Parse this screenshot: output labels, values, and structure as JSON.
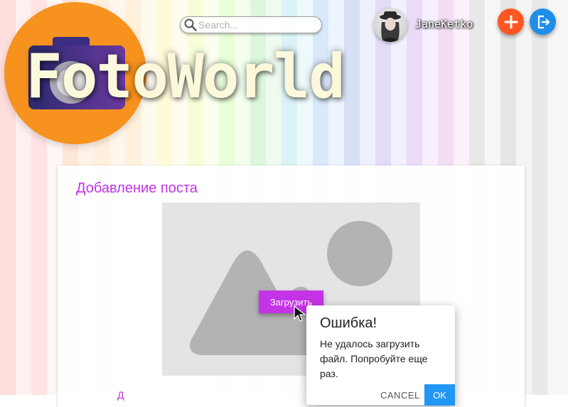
{
  "app": {
    "logo_text": "FotoWorld"
  },
  "header": {
    "search_placeholder": "Search...",
    "username": "JaneKetko",
    "add_icon": "plus-icon",
    "logout_icon": "logout-icon"
  },
  "post_form": {
    "title": "Добавление поста",
    "upload_button": "Загрузить",
    "placeholder_icon": "image-placeholder-icon",
    "bottom_label": "Д"
  },
  "error_dialog": {
    "title": "Ошибка!",
    "message": "Не удалось загрузить файл. Попробуйте еще раз.",
    "cancel_label": "CANCEL",
    "ok_label": "OK"
  },
  "colors": {
    "logo_orange": "#f7921e",
    "accent_purple": "#c433e6",
    "fab_add": "#ff5722",
    "fab_logout": "#1f8ee6",
    "dialog_ok": "#2196f3"
  }
}
